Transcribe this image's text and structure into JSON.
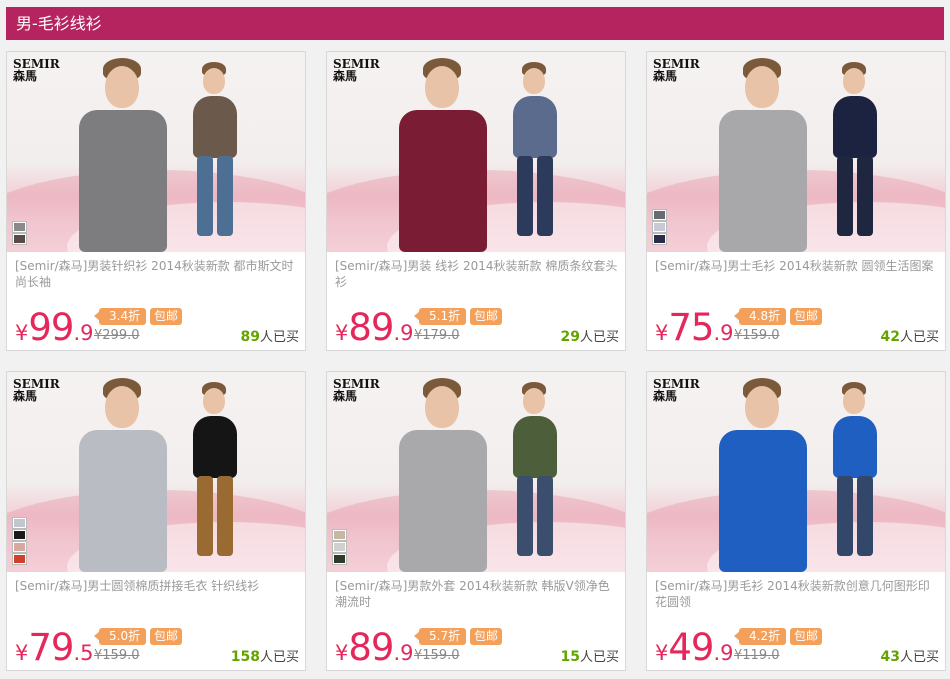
{
  "header": {
    "title": "男-毛衫线衫"
  },
  "brand": {
    "logo_en": "SEMIR",
    "logo_cn": "森馬"
  },
  "currency": "¥",
  "sold_suffix": "人已买",
  "free_shipping": "包邮",
  "products": [
    {
      "title": "[Semir/森马]男装针织衫 2014秋装新款 都市斯文时尚长袖",
      "price_int": "99",
      "price_dec": ".9",
      "discount": "3.4折",
      "original": "¥299.0",
      "sold": "89",
      "swatches": [
        "#8a8a8a",
        "#5a4a48"
      ],
      "colors": {
        "shirt": "#7d7d80",
        "pants": "#4e6f94",
        "outfit2": "#6b5a4b"
      }
    },
    {
      "title": "[Semir/森马]男装 线衫 2014秋装新款 棉质条纹套头衫",
      "price_int": "89",
      "price_dec": ".9",
      "discount": "5.1折",
      "original": "¥179.0",
      "sold": "29",
      "swatches": [],
      "colors": {
        "shirt": "#7a1d34",
        "pants": "#2c3b5c",
        "outfit2": "#5b6b8e"
      }
    },
    {
      "title": "[Semir/森马]男士毛衫 2014秋装新款 圆领生活图案",
      "price_int": "75",
      "price_dec": ".9",
      "discount": "4.8折",
      "original": "¥159.0",
      "sold": "42",
      "swatches": [
        "#6a6a72",
        "#c7c9d4",
        "#2b2d48"
      ],
      "colors": {
        "shirt": "#a8a8ab",
        "pants": "#1e2640",
        "outfit2": "#1b2340"
      }
    },
    {
      "title": "[Semir/森马]男士圆领棉质拼接毛衣 针织线衫",
      "price_int": "79",
      "price_dec": ".5",
      "discount": "5.0折",
      "original": "¥159.0",
      "sold": "158",
      "swatches": [
        "#c3c6cf",
        "#1a1a1a",
        "#d6a8a0",
        "#d1402d"
      ],
      "colors": {
        "shirt": "#b9bcc3",
        "pants": "#9a6a33",
        "outfit2": "#151515"
      }
    },
    {
      "title": "[Semir/森马]男款外套 2014秋装新款 韩版V领净色潮流时",
      "price_int": "89",
      "price_dec": ".9",
      "discount": "5.7折",
      "original": "¥159.0",
      "sold": "15",
      "swatches": [
        "#c8b7a0",
        "#d0d0d0",
        "#2f3a2a"
      ],
      "colors": {
        "shirt": "#a9a9ab",
        "pants": "#3b4e6d",
        "outfit2": "#4d5f3a"
      }
    },
    {
      "title": "[Semir/森马]男毛衫 2014秋装新款创意几何图形印花圆领",
      "price_int": "49",
      "price_dec": ".9",
      "discount": "4.2折",
      "original": "¥119.0",
      "sold": "43",
      "swatches": [],
      "colors": {
        "shirt": "#1f5fc2",
        "pants": "#33476a",
        "outfit2": "#1f5fc2"
      }
    }
  ]
}
